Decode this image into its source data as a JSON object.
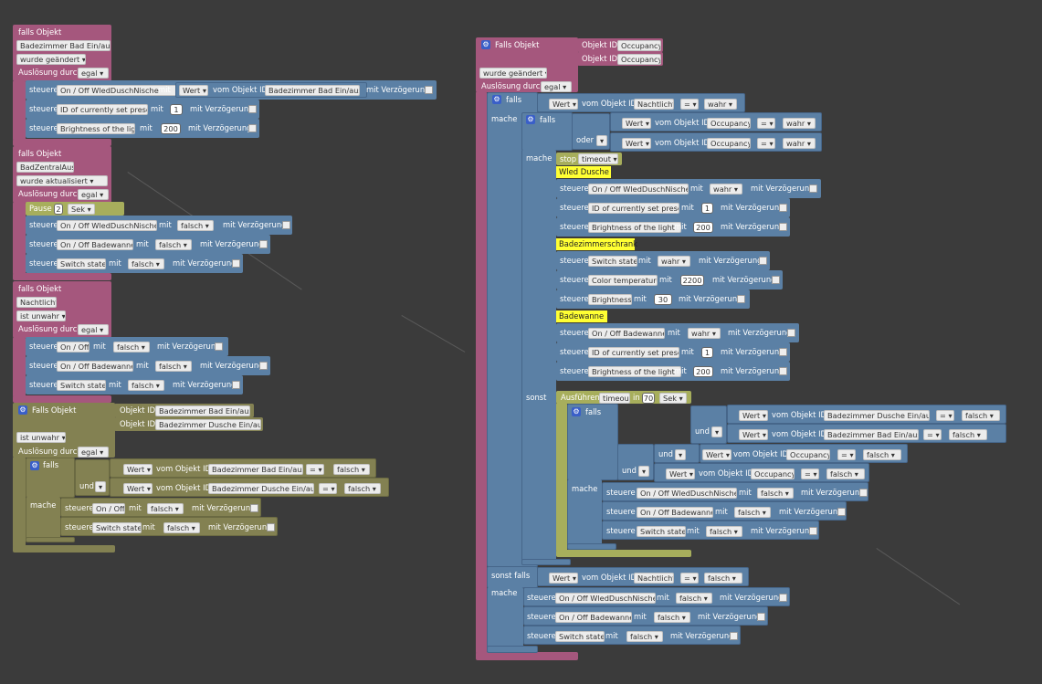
{
  "kw": {
    "falls_objekt": "falls Objekt",
    "falls_objekt_cap": "Falls Objekt",
    "ausloesung": "Auslösung durch",
    "steuere": "steuere",
    "mit": "mit",
    "mit_verz": "mit Verzögerung",
    "wert": "Wert",
    "vom_objekt_id": "vom Objekt ID",
    "objekt_id": "Objekt ID",
    "falls": "falls",
    "mache": "mache",
    "sonst": "sonst",
    "sonst_falls": "sonst falls",
    "und": "und",
    "oder": "oder",
    "eq": "=",
    "pause": "Pause",
    "sek": "Sek",
    "stop": "stop",
    "ausfuehren": "Ausführen",
    "in": "in"
  },
  "v": {
    "egal": "egal",
    "wahr": "wahr",
    "falsch": "falsch",
    "wurde_geaendert": "wurde geändert",
    "wurde_aktualisiert": "wurde aktualisiert",
    "ist_unwahr": "ist unwahr",
    "timeout": "timeout"
  },
  "obj": {
    "bad_ein_aus": "Badezimmer Bad Ein/aus",
    "dusche_ein_aus": "Badezimmer Dusche Ein/aus",
    "zentral_aus": "BadZentralAus",
    "nachtlicht": "Nachtlicht",
    "occupancy": "Occupancy"
  },
  "prop": {
    "onoff_wled": "On / Off WledDuschNische",
    "preset": "ID of currently set preset",
    "brightness_light": "Brightness of the light",
    "onoff_wanne": "On / Off Badewanne",
    "switch_state": "Switch state",
    "onoff": "On / Off",
    "color_temp": "Color temperature",
    "brightness": "Brightness"
  },
  "num": {
    "one": "1",
    "two": "2",
    "b200": "200",
    "c2200": "2200",
    "b30": "30",
    "t70": "70"
  },
  "comments": {
    "wled": "Wled Dusche",
    "schrank": "Badezimmerschrank",
    "wanne": "Badewanne"
  }
}
